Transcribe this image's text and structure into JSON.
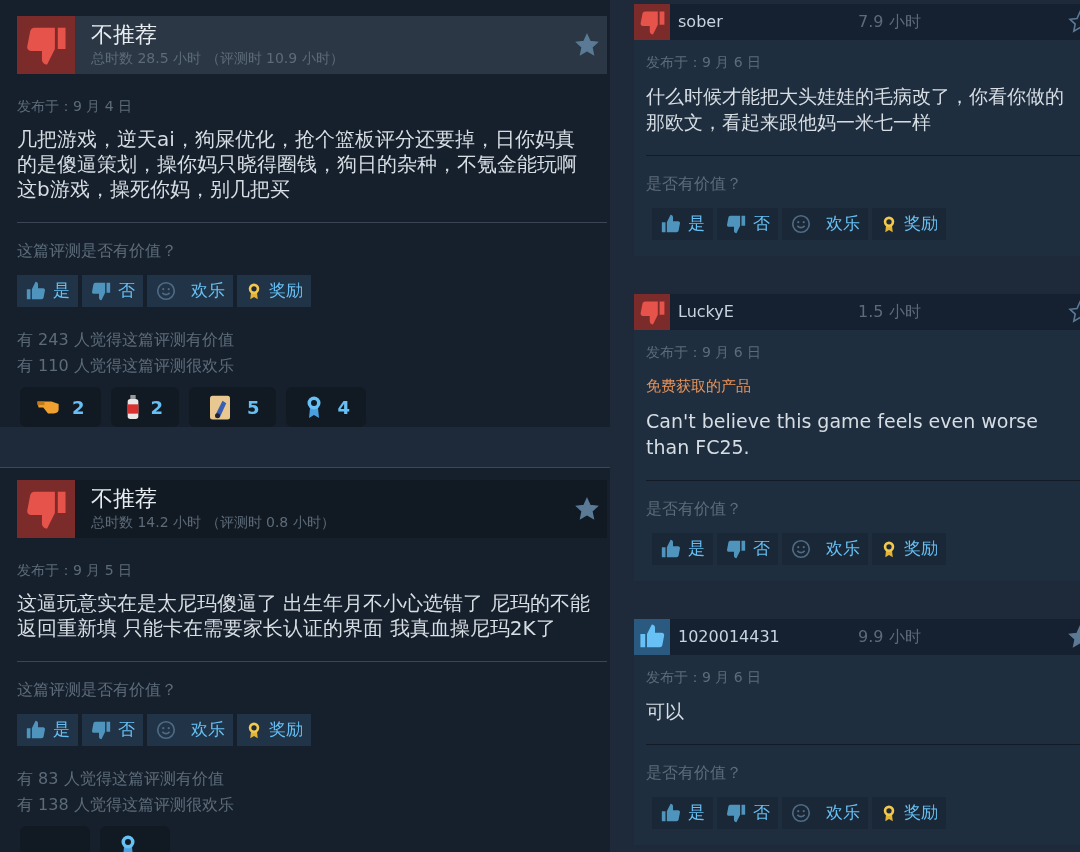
{
  "left_reviews": [
    {
      "recommended": false,
      "highlighted": true,
      "title": "不推荐",
      "hours": "总时数 28.5 小时 （评测时 10.9 小时）",
      "starred": true,
      "posted": "发布于：9 月 4 日",
      "text": "几把游戏，逆天ai，狗屎优化，抢个篮板评分还要掉，日你妈真的是傻逼策划，操你妈只晓得圈钱，狗日的杂种，不氪金能玩啊这b游戏，操死你妈，别几把买",
      "question": "这篇评测是否有价值？",
      "buttons": [
        {
          "kind": "yes",
          "label": "是"
        },
        {
          "kind": "no",
          "label": "否"
        },
        {
          "kind": "funny",
          "label": "欢乐"
        },
        {
          "kind": "award",
          "label": "奖励"
        }
      ],
      "stats": [
        "有 243 人觉得这篇评测有价值",
        "有 110 人觉得这篇评测很欢乐"
      ],
      "awards": [
        {
          "kind": "hand",
          "count": "2"
        },
        {
          "kind": "can",
          "count": "2"
        },
        {
          "kind": "scroll",
          "count": "5"
        },
        {
          "kind": "ribbon",
          "count": "4"
        }
      ]
    },
    {
      "recommended": false,
      "highlighted": false,
      "title": "不推荐",
      "hours": "总时数 14.2 小时 （评测时 0.8 小时）",
      "starred": true,
      "posted": "发布于：9 月 5 日",
      "text": "这逼玩意实在是太尼玛傻逼了 出生年月不小心选错了 尼玛的不能返回重新填 只能卡在需要家长认证的界面 我真血操尼玛2K了",
      "question": "这篇评测是否有价值？",
      "buttons": [
        {
          "kind": "yes",
          "label": "是"
        },
        {
          "kind": "no",
          "label": "否"
        },
        {
          "kind": "funny",
          "label": "欢乐"
        },
        {
          "kind": "award",
          "label": "奖励"
        }
      ],
      "stats": [
        "有 83 人觉得这篇评测有价值",
        "有 138 人觉得这篇评测很欢乐"
      ],
      "awards": [
        {
          "kind": "blank"
        },
        {
          "kind": "ribbon"
        }
      ]
    }
  ],
  "right_reviews": [
    {
      "recommended": false,
      "user": "sober",
      "hours": "7.9 小时",
      "starred": false,
      "posted": "发布于：9 月 6 日",
      "text": "什么时候才能把大头娃娃的毛病改了，你看你做的那欧文，看起来跟他妈一米七一样",
      "question": "是否有价值？",
      "buttons": [
        {
          "kind": "yes",
          "label": "是"
        },
        {
          "kind": "no",
          "label": "否"
        },
        {
          "kind": "funny",
          "label": "欢乐"
        },
        {
          "kind": "award",
          "label": "奖励"
        }
      ]
    },
    {
      "recommended": false,
      "user": "LuckyE",
      "hours": "1.5 小时",
      "starred": false,
      "posted": "发布于：9 月 6 日",
      "tag": "免费获取的产品",
      "text": "Can't believe this game feels even worse than FC25.",
      "question": "是否有价值？",
      "buttons": [
        {
          "kind": "yes",
          "label": "是"
        },
        {
          "kind": "no",
          "label": "否"
        },
        {
          "kind": "funny",
          "label": "欢乐"
        },
        {
          "kind": "award",
          "label": "奖励"
        }
      ]
    },
    {
      "recommended": true,
      "user": "1020014431",
      "hours": "9.9 小时",
      "starred": true,
      "posted": "发布于：9 月 6 日",
      "text": "可以",
      "question": "是否有价值？",
      "buttons": [
        {
          "kind": "yes",
          "label": "是"
        },
        {
          "kind": "no",
          "label": "否"
        },
        {
          "kind": "funny",
          "label": "欢乐"
        },
        {
          "kind": "award",
          "label": "奖励"
        }
      ]
    }
  ]
}
